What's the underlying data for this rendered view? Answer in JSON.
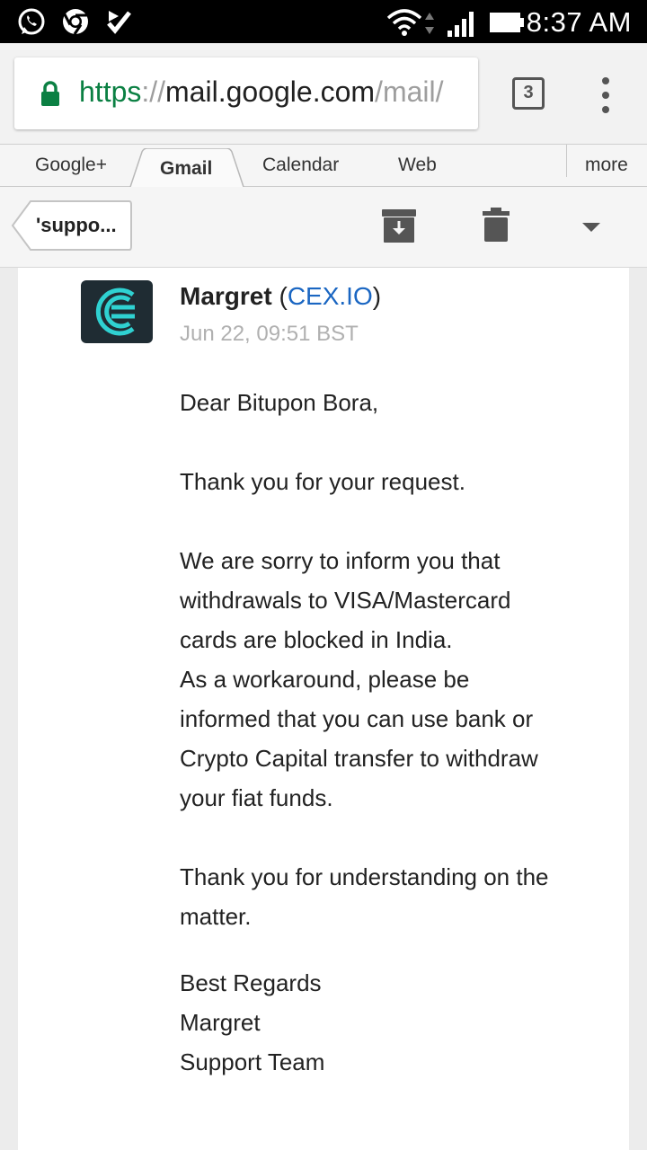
{
  "status_bar": {
    "time": "8:37 AM",
    "left_icons": [
      "whatsapp-icon",
      "chrome-icon",
      "check-app-icon"
    ],
    "right_icons": [
      "wifi-icon",
      "signal-icon",
      "battery-icon"
    ]
  },
  "browser": {
    "url_scheme": "https",
    "url_sep": "://",
    "url_host": "mail.google.com",
    "url_path": "/mail/",
    "tab_count": "3",
    "secure_color": "#0b8043"
  },
  "google_bar": {
    "tabs": [
      "Google+",
      "Gmail",
      "Calendar",
      "Web"
    ],
    "active_tab": "Gmail",
    "more_label": "more"
  },
  "action_bar": {
    "back_label": "'suppo..."
  },
  "message": {
    "sender_name": "Margret",
    "sender_org_open": " (",
    "sender_org": "CEX.IO",
    "sender_org_close": ")",
    "date": "Jun 22, 09:51 BST",
    "greeting": "Dear Bitupon Bora,",
    "para1": "Thank you for your request.",
    "para2_lines": [
      "We are sorry to inform you that",
      "withdrawals to VISA/Mastercard",
      "cards are blocked in India.",
      "As a workaround, please be",
      "informed that you can use bank or",
      "Crypto Capital transfer to withdraw",
      "your fiat funds."
    ],
    "para3_lines": [
      "Thank you for understanding on the",
      "matter."
    ],
    "signoff_lines": [
      "Best Regards",
      "Margret",
      "Support Team"
    ],
    "link_color": "#1a66c2"
  }
}
